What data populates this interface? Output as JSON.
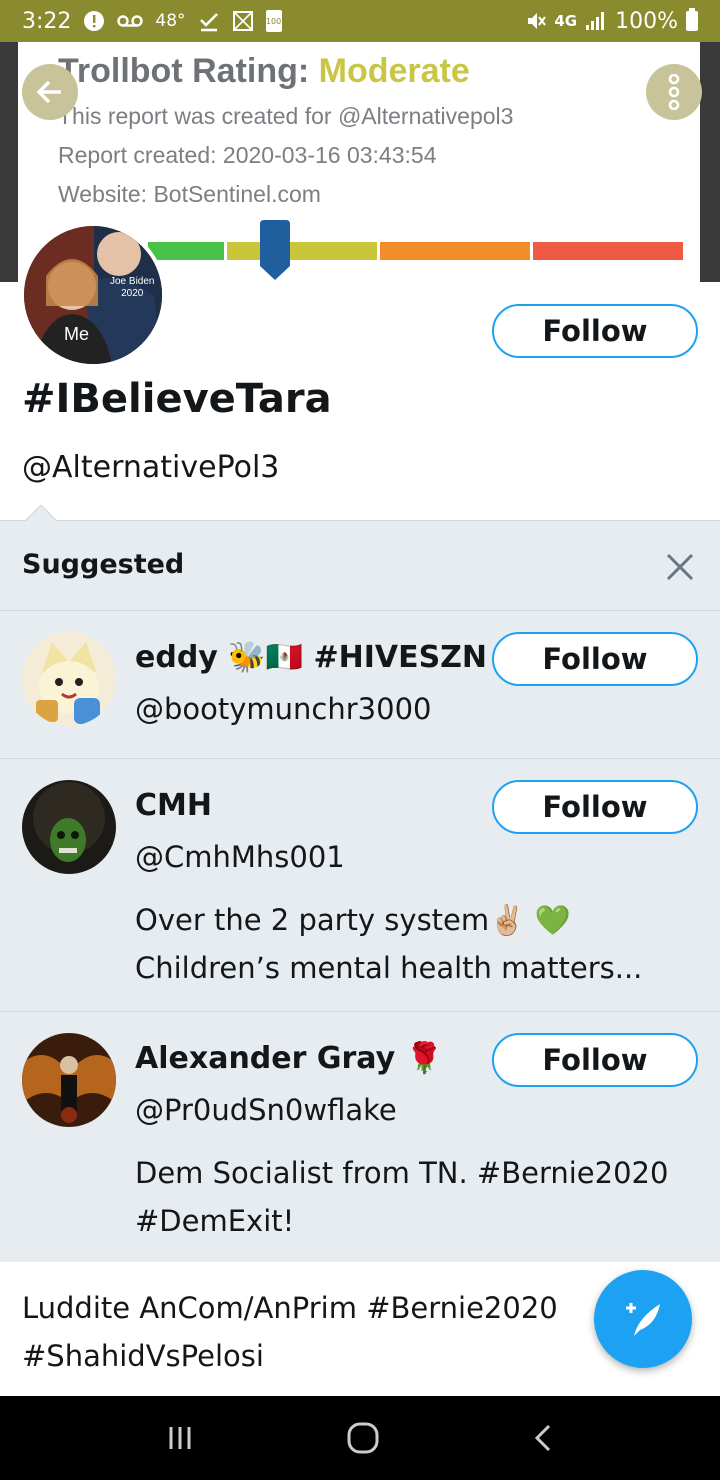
{
  "status_bar": {
    "time": "3:22",
    "temperature": "48°",
    "battery_small": "100",
    "network": "4G",
    "battery": "100%"
  },
  "report": {
    "rating_label": "Trollbot Rating:",
    "rating_value": "Moderate",
    "created_for": "This report was created for @Alternativepol3",
    "created_at": "Report created: 2020-03-16 03:43:54",
    "website": "Website: BotSentinel.com",
    "meter_colors": [
      "#49c24a",
      "#c9c63c",
      "#c9c63c",
      "#f28d2c",
      "#ef5a45"
    ],
    "meter_position": 0.3
  },
  "profile": {
    "avatar_text_top": "Joe Biden\n2020",
    "avatar_text_bottom": "Me",
    "display_name": "#IBelieveTara",
    "handle": "@AlternativePol3",
    "follow_label": "Follow"
  },
  "suggested": {
    "title": "Suggested",
    "close_icon": "close-icon",
    "users": [
      {
        "name": "eddy 🐝🇲🇽 #HIVESZN",
        "handle": "@bootymunchr3000",
        "bio": "",
        "follow_label": "Follow"
      },
      {
        "name": "CMH",
        "handle": "@CmhMhs001",
        "bio": "Over the 2 party system✌🏼 💚 Children’s mental health matters...",
        "follow_label": "Follow"
      },
      {
        "name": "Alexander Gray 🌹",
        "handle": "@Pr0udSn0wflake",
        "bio": "Dem Socialist from TN. #Bernie2020 #DemExit!",
        "follow_label": "Follow"
      }
    ]
  },
  "bottom_bio": "Luddite AnCom/AnPrim #Bernie2020 #ShahidVsPelosi",
  "colors": {
    "accent": "#1da1f2",
    "status_bar": "#8a8a2e",
    "suggested_bg": "#e6ecf0"
  }
}
